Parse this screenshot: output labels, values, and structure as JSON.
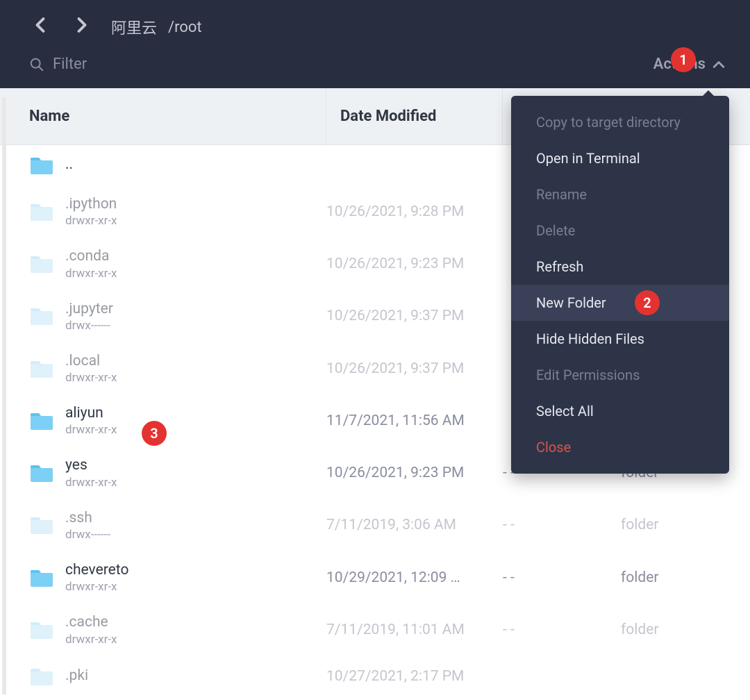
{
  "header": {
    "breadcrumb_host": "阿里云",
    "breadcrumb_path": "/root",
    "filter_placeholder": "Filter",
    "actions_label": "Actions"
  },
  "columns": {
    "name": "Name",
    "date": "Date Modified",
    "size": "",
    "type": ""
  },
  "files": [
    {
      "name": "..",
      "perms": "",
      "date": "",
      "size": "",
      "type": "",
      "hidden": false
    },
    {
      "name": ".ipython",
      "perms": "drwxr-xr-x",
      "date": "10/26/2021, 9:28 PM",
      "size": "",
      "type": "",
      "hidden": true
    },
    {
      "name": ".conda",
      "perms": "drwxr-xr-x",
      "date": "10/26/2021, 9:23 PM",
      "size": "",
      "type": "",
      "hidden": true
    },
    {
      "name": ".jupyter",
      "perms": "drwx------",
      "date": "10/26/2021, 9:37 PM",
      "size": "",
      "type": "",
      "hidden": true
    },
    {
      "name": ".local",
      "perms": "drwxr-xr-x",
      "date": "10/26/2021, 9:37 PM",
      "size": "",
      "type": "",
      "hidden": true
    },
    {
      "name": "aliyun",
      "perms": "drwxr-xr-x",
      "date": "11/7/2021, 11:56 AM",
      "size": "",
      "type": "",
      "hidden": false
    },
    {
      "name": "yes",
      "perms": "drwxr-xr-x",
      "date": "10/26/2021, 9:23 PM",
      "size": "- -",
      "type": "folder",
      "hidden": false
    },
    {
      "name": ".ssh",
      "perms": "drwx------",
      "date": "7/11/2019, 3:06 AM",
      "size": "- -",
      "type": "folder",
      "hidden": true
    },
    {
      "name": "chevereto",
      "perms": "drwxr-xr-x",
      "date": "10/29/2021, 12:09 …",
      "size": "- -",
      "type": "folder",
      "hidden": false
    },
    {
      "name": ".cache",
      "perms": "drwxr-xr-x",
      "date": "7/11/2019, 11:01 AM",
      "size": "- -",
      "type": "folder",
      "hidden": true
    },
    {
      "name": ".pki",
      "perms": "",
      "date": "10/27/2021, 2:17 PM",
      "size": "",
      "type": "",
      "hidden": true
    }
  ],
  "menu": {
    "copy": "Copy to target directory",
    "open_terminal": "Open in Terminal",
    "rename": "Rename",
    "delete": "Delete",
    "refresh": "Refresh",
    "new_folder": "New Folder",
    "hide_hidden": "Hide Hidden Files",
    "edit_perms": "Edit Permissions",
    "select_all": "Select All",
    "close": "Close"
  },
  "annotations": {
    "b1": "1",
    "b2": "2",
    "b3": "3"
  }
}
